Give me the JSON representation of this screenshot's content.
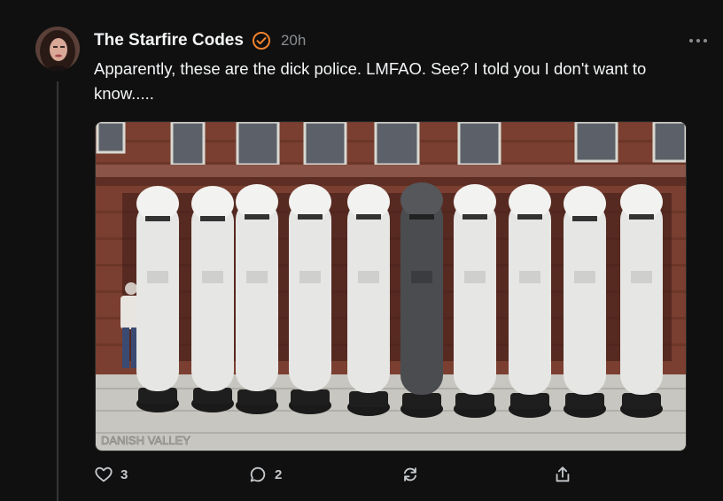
{
  "post": {
    "author": "The Starfire Codes",
    "timestamp": "20h",
    "text": "Apparently, these are the dick police. LMFAO. See? I told you I don't want to know.....",
    "verified_icon": "verified-badge-icon",
    "accent_color": "#f0822d",
    "media": {
      "watermark": "DANISH VALLEY"
    }
  },
  "actions": {
    "like_count": "3",
    "reply_count": "2",
    "repost_label": "",
    "share_label": ""
  }
}
